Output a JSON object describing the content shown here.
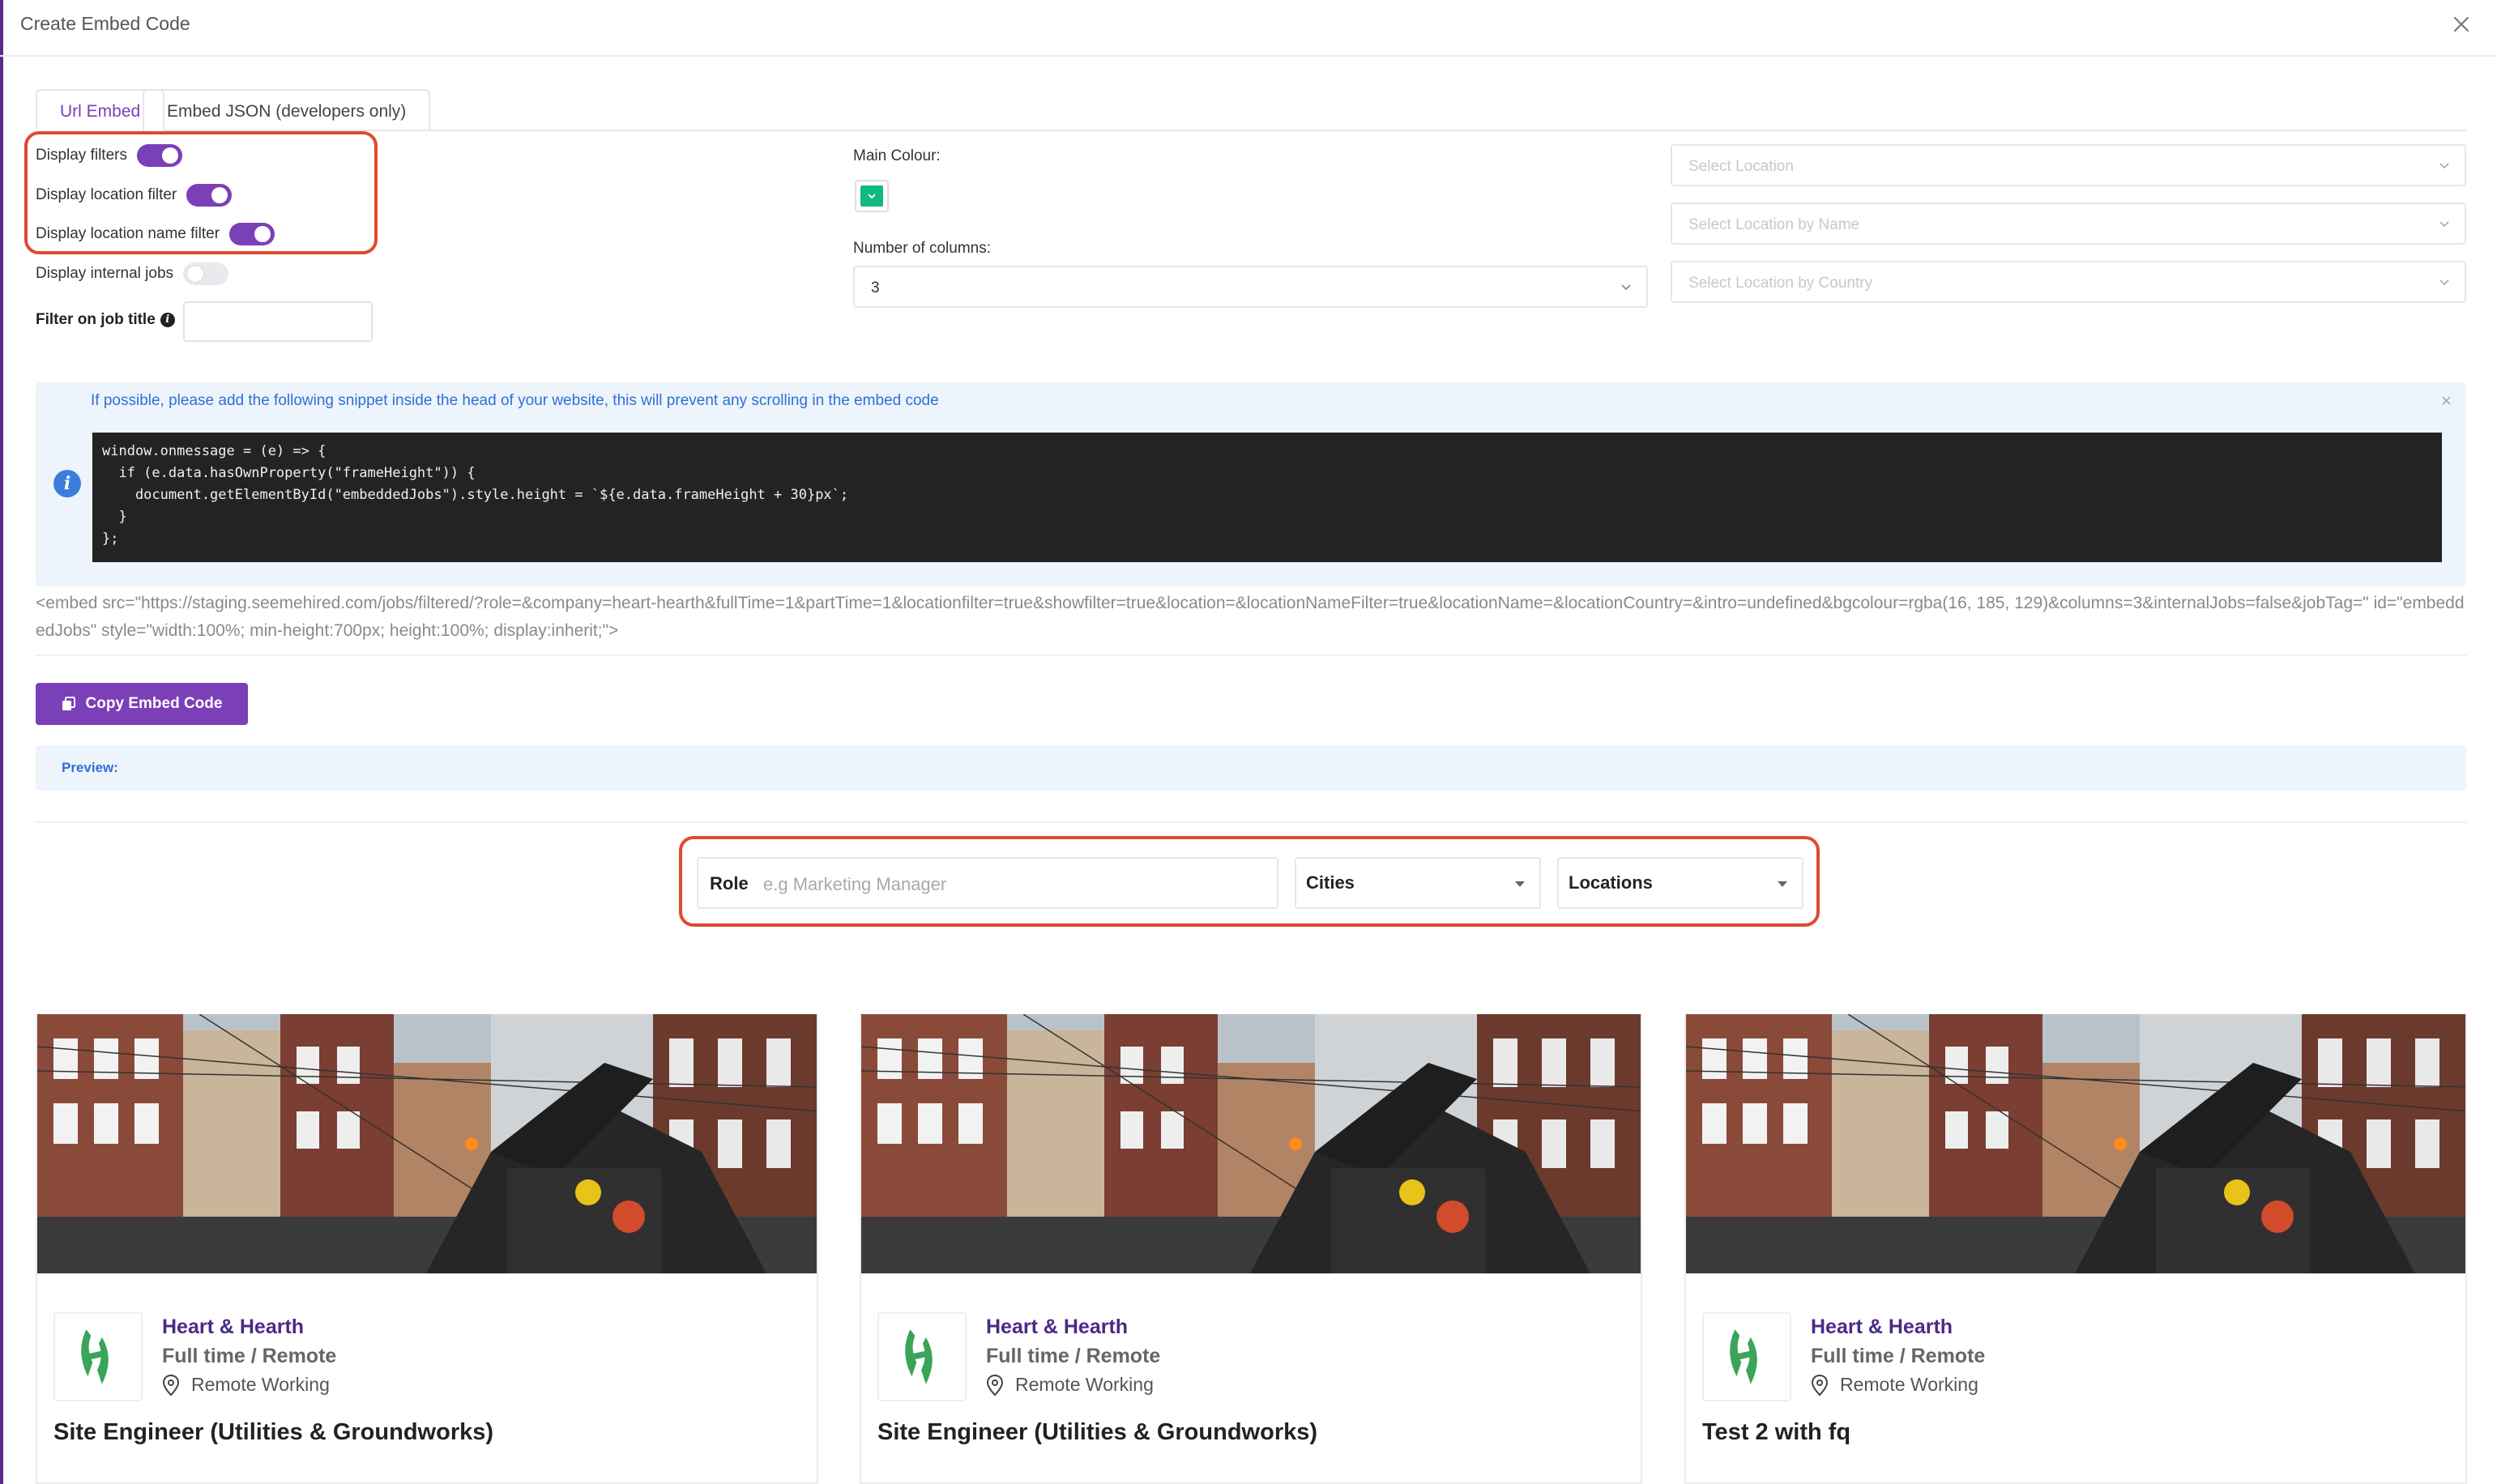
{
  "modal": {
    "title": "Create Embed Code"
  },
  "tabs": [
    {
      "label": "Url Embed",
      "active": true
    },
    {
      "label": "Embed JSON (developers only)",
      "active": false
    }
  ],
  "toggles": [
    {
      "label": "Display filters",
      "on": true
    },
    {
      "label": "Display location filter",
      "on": true
    },
    {
      "label": "Display location name filter",
      "on": true
    },
    {
      "label": "Display internal jobs",
      "on": false
    }
  ],
  "filter_job_title": {
    "label": "Filter on job title",
    "value": ""
  },
  "main_colour": {
    "label": "Main Colour:",
    "color": "#10b981"
  },
  "columns": {
    "label": "Number of columns:",
    "value": "3"
  },
  "location_selects": [
    {
      "placeholder": "Select Location"
    },
    {
      "placeholder": "Select Location by Name"
    },
    {
      "placeholder": "Select Location by Country"
    }
  ],
  "snippet": {
    "message": "If possible, please add the following snippet inside the head of your website, this will prevent any scrolling in the embed code",
    "close": "×",
    "code": "window.onmessage = (e) => {\n  if (e.data.hasOwnProperty(\"frameHeight\")) {\n    document.getElementById(\"embeddedJobs\").style.height = `${e.data.frameHeight + 30}px`;\n  }\n};"
  },
  "embed_code": "<embed src=\"https://staging.seemehired.com/jobs/filtered/?role=&company=heart-hearth&fullTime=1&partTime=1&locationfilter=true&showfilter=true&location=&locationNameFilter=true&locationName=&locationCountry=&intro=undefined&bgcolour=rgba(16, 185, 129)&columns=3&internalJobs=false&jobTag=\" id=\"embeddedJobs\" style=\"width:100%; min-height:700px; height:100%; display:inherit;\">",
  "copy_button": {
    "label": "Copy Embed Code"
  },
  "preview": {
    "label": "Preview:",
    "role_label": "Role",
    "role_placeholder": "e.g Marketing Manager",
    "cities_label": "Cities",
    "locations_label": "Locations"
  },
  "jobs": [
    {
      "company": "Heart & Hearth",
      "type": "Full time / Remote",
      "location": "Remote Working",
      "title": "Site Engineer (Utilities & Groundworks)"
    },
    {
      "company": "Heart & Hearth",
      "type": "Full time / Remote",
      "location": "Remote Working",
      "title": "Site Engineer (Utilities & Groundworks)"
    },
    {
      "company": "Heart & Hearth",
      "type": "Full time / Remote",
      "location": "Remote Working",
      "title": "Test 2 with fq"
    }
  ],
  "colors": {
    "accent": "#7b3fb8",
    "highlight": "#e04a2f",
    "info_blue": "#2f6fd6"
  }
}
